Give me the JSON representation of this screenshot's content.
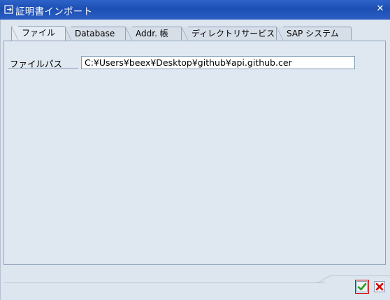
{
  "window": {
    "title": "証明書インポート",
    "close_label": "✕"
  },
  "tabs": [
    {
      "label": "ファイル",
      "active": true
    },
    {
      "label": "Database",
      "active": false
    },
    {
      "label": "Addr. 帳",
      "active": false
    },
    {
      "label": "ディレクトリサービス",
      "active": false
    },
    {
      "label": "SAP システム",
      "active": false
    }
  ],
  "file_tab": {
    "path_label": "ファイルパス",
    "path_value": "C:¥Users¥beex¥Desktop¥github¥api.github.cer"
  },
  "colors": {
    "titlebar": "#1c4fb4",
    "ok_green": "#2e9b1f",
    "cancel_red": "#d40000"
  },
  "icons": {
    "title": "import-dialog-icon",
    "ok": "checkmark-icon",
    "cancel": "x-cancel-icon"
  }
}
